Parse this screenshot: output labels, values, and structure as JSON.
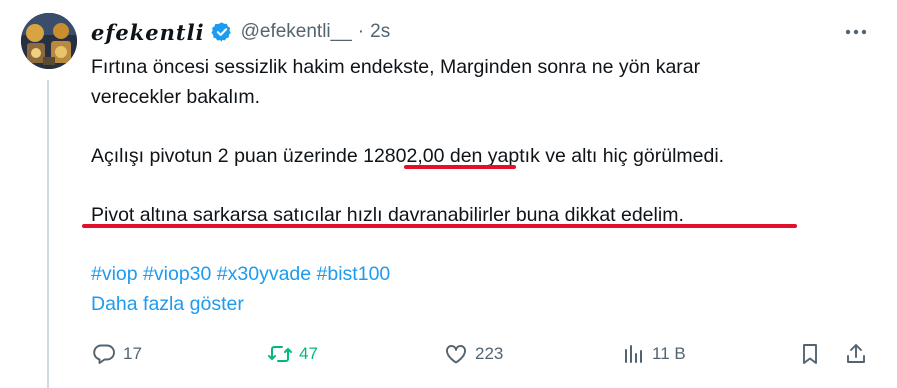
{
  "tweet": {
    "display_name": "efekentli",
    "handle": "@efekentli__",
    "separator": "·",
    "time": "2s",
    "lines": [
      "Fırtına öncesi sessizlik hakim endekste, Marginden sonra ne yön karar",
      "verecekler bakalım."
    ],
    "line3_pre": "Açılışı pivotun 2 puan üzerinde ",
    "line3_highlight": "12802,00",
    "line3_post": " den yaptık ve altı hiç görülmedi.",
    "line4": "Pivot altına sarkarsa satıcılar hızlı davranabilirler buna dikkat edelim.",
    "hashtags": [
      "#viop",
      "#viop30",
      "#x30yvade",
      "#bist100"
    ],
    "show_more": "Daha fazla göster"
  },
  "actions": {
    "reply_count": "17",
    "retweet_count": "47",
    "like_count": "223",
    "views_count": "11 B"
  },
  "colors": {
    "link": "#1d9bf0",
    "retweet": "#00ba7c",
    "underline": "#e2102b",
    "muted": "#536471",
    "verified": "#1d9bf0"
  },
  "icons": [
    "verified-badge-icon",
    "more-icon",
    "reply-icon",
    "retweet-icon",
    "like-icon",
    "views-icon",
    "bookmark-icon",
    "share-icon"
  ]
}
